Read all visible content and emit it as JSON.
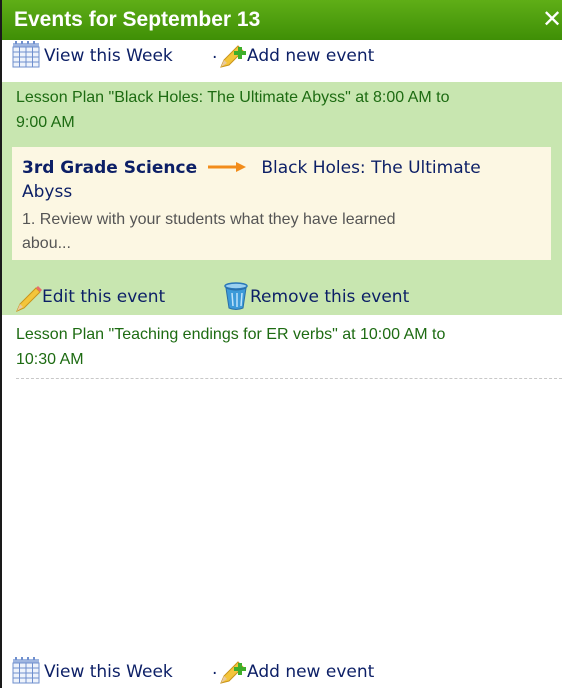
{
  "titlebar": {
    "title": "Events for September 13",
    "close_label": "✕"
  },
  "toolbar": {
    "view_week": "View this Week",
    "separator": ".",
    "add_event": "Add new event"
  },
  "events": [
    {
      "summary_line1": "Lesson Plan \"Black Holes: The Ultimate Abyss\" at 8:00 AM to",
      "summary_line2": "9:00 AM",
      "class_name": "3rd Grade Science",
      "lesson_title_line1": "Black Holes: The Ultimate",
      "lesson_title_line2": "Abyss",
      "description_line1": "1. Review with your students what they have learned",
      "description_line2": "abou...",
      "edit_label": "Edit this event",
      "remove_label": "Remove this event"
    },
    {
      "summary_line1": "Lesson Plan \"Teaching endings for ER verbs\" at 10:00 AM to",
      "summary_line2": "10:30 AM"
    }
  ],
  "colors": {
    "title_bar": "#4a9a0c",
    "event_highlight": "#c8e6b0",
    "event_card": "#fcf7e3",
    "link_navy": "#0c1f66",
    "event_text_green": "#1d6b12",
    "arrow_orange": "#f28c1a"
  },
  "icons": {
    "calendar": "calendar-icon",
    "pencil_plus": "add-pencil-icon",
    "pencil": "edit-pencil-icon",
    "trash": "trash-can-icon",
    "arrow": "arrow-right-icon",
    "close": "close-icon"
  }
}
